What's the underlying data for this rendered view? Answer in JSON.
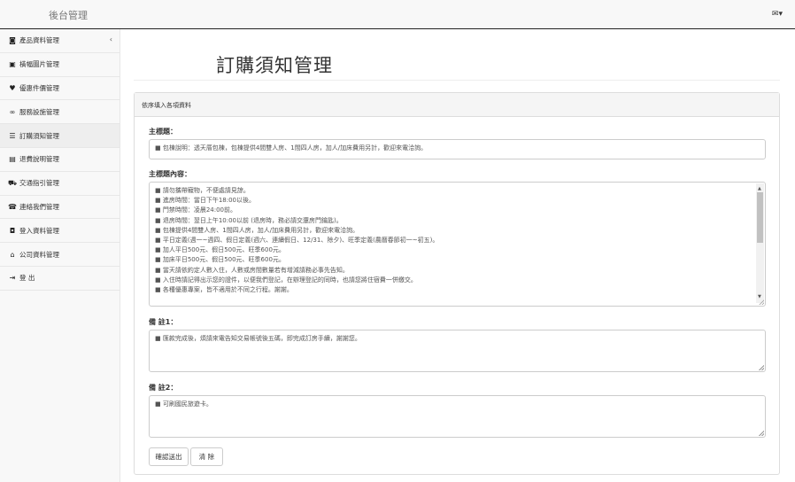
{
  "header": {
    "brand": "後台管理",
    "user_menu_icon": "envelope-icon",
    "caret": "▾"
  },
  "sidebar": {
    "items": [
      {
        "icon": "camera-icon",
        "label": "產品資料管理"
      },
      {
        "icon": "image-icon",
        "label": "橫幅圖片管理"
      },
      {
        "icon": "heart-icon",
        "label": "優惠件價管理"
      },
      {
        "icon": "link-icon",
        "label": "服務設施管理"
      },
      {
        "icon": "list-icon",
        "label": "訂購須知管理"
      },
      {
        "icon": "document-icon",
        "label": "退費說明管理"
      },
      {
        "icon": "car-icon",
        "label": "交通指引管理"
      },
      {
        "icon": "phone-icon",
        "label": "連絡我們管理"
      },
      {
        "icon": "users-icon",
        "label": "登入資料管理"
      },
      {
        "icon": "bank-icon",
        "label": "公司資料管理"
      },
      {
        "icon": "logout-icon",
        "label": "登 出"
      }
    ],
    "active_index": 4
  },
  "main": {
    "title": "訂購須知管理",
    "panel_heading": "依序填入各項資料",
    "fields": {
      "subject_label": "主標題：",
      "subject_value": "■ 包棟說明：透天厝包棟，包棟提供4間雙人房、1間四人房，加人/加床費用另計，歡迎來電洽詢。",
      "content_label": "主標題內容：",
      "content_lines": [
        "■ 請勿攜帶寵物，不便處請見諒。",
        "■ 進房時間：當日下午18:00以後。",
        "■ 門禁時間：凌晨24:00前。",
        "■ 退房時間：翌日上午10:00以前 (退房時，務必請交還房門鑰匙)。",
        "■ 包棟提供4間雙人房、1間四人房，加人/加床費用另計，歡迎來電洽詢。",
        "■ 平日定義(週一~週四、假日定義(週六、連續假日、12/31、除夕)、旺季定義(農曆春節初一~初五)。",
        "■ 加人平日500元、假日500元、旺季600元。",
        "■ 加床平日500元、假日500元、旺季600元。",
        "■ 當天請依約定人數入住，人數或房間數量若有增減請務必事先告知。",
        "■ 入住時請記得出示您的證件，以便我們登記，在辦理登記的同時，也請您將住宿費一併繳交。",
        "■ 各種優惠專案，皆不適用於不同之行程。謝謝。"
      ],
      "note1_label": "備 註1：",
      "note1_value": "■ 匯款完成後，煩請來電告知交易帳號後五碼，即完成訂房手續，謝謝您。",
      "note2_label": "備 註2：",
      "note2_value": "■ 可刷國民旅遊卡。"
    },
    "buttons": {
      "submit": "確認送出",
      "clear": "清 除"
    }
  }
}
